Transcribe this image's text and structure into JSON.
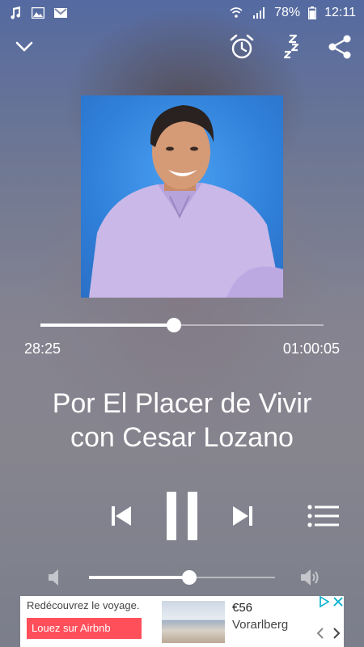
{
  "status_bar": {
    "battery": "78%",
    "time": "12:11"
  },
  "player": {
    "current_time": "28:25",
    "duration": "01:00:05",
    "progress_fraction": 0.47,
    "title_line1": "Por El Placer de Vivir",
    "title_line2": "con Cesar Lozano",
    "volume_fraction": 0.54
  },
  "icons": {
    "collapse": "chevron-down-icon",
    "alarm": "alarm-clock-icon",
    "sleep": "sleep-timer-icon",
    "share": "share-icon",
    "previous": "skip-previous-icon",
    "pause": "pause-icon",
    "next": "skip-next-icon",
    "queue": "queue-list-icon",
    "volume_low": "volume-low-icon",
    "volume_high": "volume-high-icon"
  },
  "ad": {
    "tagline": "Redécouvrez le voyage.",
    "cta": "Louez sur Airbnb",
    "price": "€56",
    "location": "Vorarlberg"
  },
  "colors": {
    "accent": "#ffffff",
    "ad_cta": "#ff4f5a",
    "ad_choice": "#00aecd"
  }
}
